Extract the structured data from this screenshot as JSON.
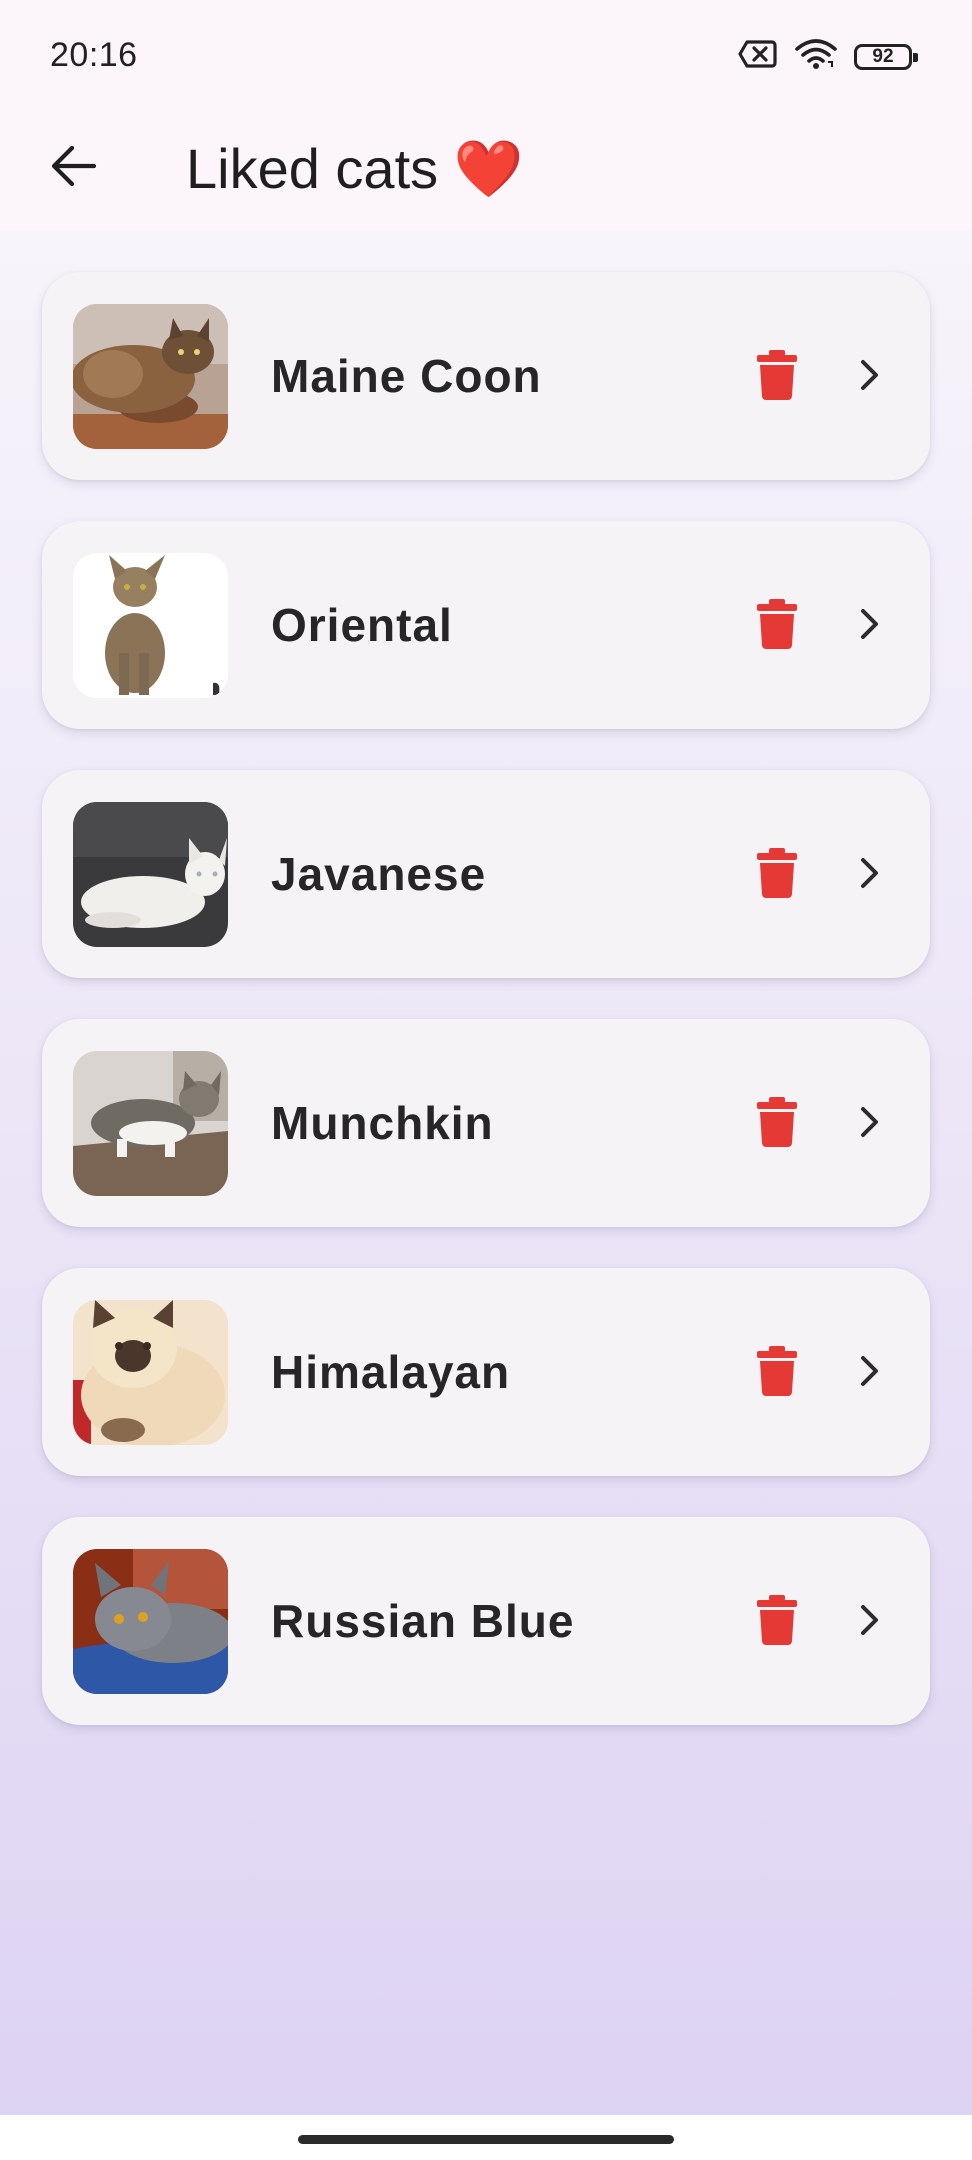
{
  "status_bar": {
    "time": "20:16",
    "battery_level": "92",
    "icons": [
      "sim-off-icon",
      "wifi-icon",
      "battery-icon"
    ]
  },
  "app_bar": {
    "title": "Liked cats ❤️",
    "back_icon": "arrow-left-icon"
  },
  "colors": {
    "delete_red": "#e53935",
    "text_dark": "#262626",
    "card_bg": "#f5f3f6"
  },
  "cats": [
    {
      "name": "Maine Coon",
      "delete_icon": "trash-icon",
      "open_icon": "chevron-right-icon"
    },
    {
      "name": "Oriental",
      "delete_icon": "trash-icon",
      "open_icon": "chevron-right-icon"
    },
    {
      "name": "Javanese",
      "delete_icon": "trash-icon",
      "open_icon": "chevron-right-icon"
    },
    {
      "name": "Munchkin",
      "delete_icon": "trash-icon",
      "open_icon": "chevron-right-icon"
    },
    {
      "name": "Himalayan",
      "delete_icon": "trash-icon",
      "open_icon": "chevron-right-icon"
    },
    {
      "name": "Russian Blue",
      "delete_icon": "trash-icon",
      "open_icon": "chevron-right-icon"
    }
  ]
}
